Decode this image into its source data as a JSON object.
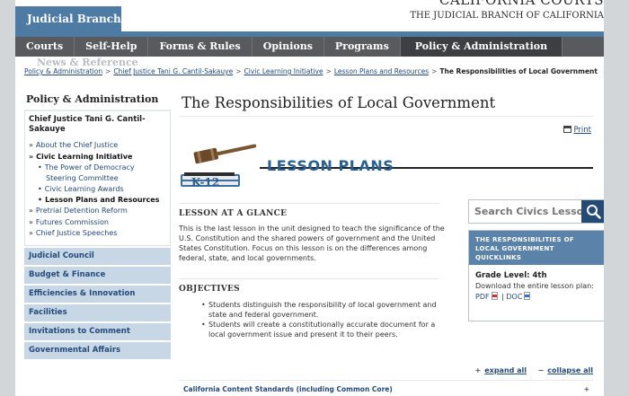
{
  "header": {
    "site_tab": "Judicial Branch",
    "site_title": "CALIFORNIA COURTS",
    "site_subtitle": "THE JUDICIAL BRANCH OF CALIFORNIA"
  },
  "nav": {
    "items": [
      "Courts",
      "Self-Help",
      "Forms & Rules",
      "Opinions",
      "Programs",
      "Policy & Administration"
    ],
    "overflow_item": "News & Reference",
    "active_index": 5
  },
  "breadcrumb": {
    "items": [
      "Policy & Administration",
      "Chief Justice Tani G. Cantil-Sakauye",
      "Civic Learning Initiative",
      "Lesson Plans and Resources"
    ],
    "separator": ">",
    "current": "The Responsibilities of Local Government"
  },
  "sidebar": {
    "title": "Policy & Administration",
    "heading": "Chief Justice Tani G. Cantil-Sakauye",
    "bullet": "»",
    "links": {
      "about": "About the Chief Justice",
      "civic": "Civic Learning Initiative",
      "power_line1": "The Power of Democracy",
      "power_line2": "Steering Committee",
      "awards": "Civic Learning Awards",
      "lesson_plans": "Lesson Plans and Resources",
      "pretrial": "Pretrial Detention Reform",
      "futures": "Futures Commission",
      "speeches": "Chief Justice Speeches"
    },
    "blocks": [
      "Judicial Council",
      "Budget & Finance",
      "Efficiencies & Innovation",
      "Facilities",
      "Invitations to Comment",
      "Governmental Affairs"
    ]
  },
  "main": {
    "title": "The Responsibilities of Local Government",
    "print_label": "Print",
    "banner_text": "LESSON PLANS",
    "badge_text": "K-12",
    "glance_title": "LESSON AT A GLANCE",
    "glance_text": "This is the last lesson in the unit designed to teach the significance of the U.S. Constitution and the shared powers of government and the United States Constitution.  Focus on this lesson is on the differences among federal, state, and local governments.",
    "objectives_title": "OBJECTIVES",
    "objectives": [
      "Students distinguish the responsibility of local government and state and federal government.",
      "Students will create a constitutionally accurate document for a local government issue and present it to their peers."
    ],
    "expand_label": "expand all",
    "collapse_label": "collapse all",
    "standards_label": "California Content Standards (including Common Core)"
  },
  "search": {
    "placeholder": "Search Civics Lessons"
  },
  "quicklinks": {
    "heading": "THE RESPONSIBILITIES OF LOCAL GOVERNMENT QUICKLINKS",
    "grade": "Grade Level: 4th",
    "download": "Download the entire lesson plan:",
    "pdf_label": "PDF",
    "doc_label": "DOC",
    "divider": "|"
  },
  "colors": {
    "brand_blue": "#4d7ba4",
    "nav_gray": "#585a5d",
    "link_blue": "#244a7a",
    "sidebar_block": "#c7d7e6",
    "quicklinks_head": "#5b82a8"
  }
}
